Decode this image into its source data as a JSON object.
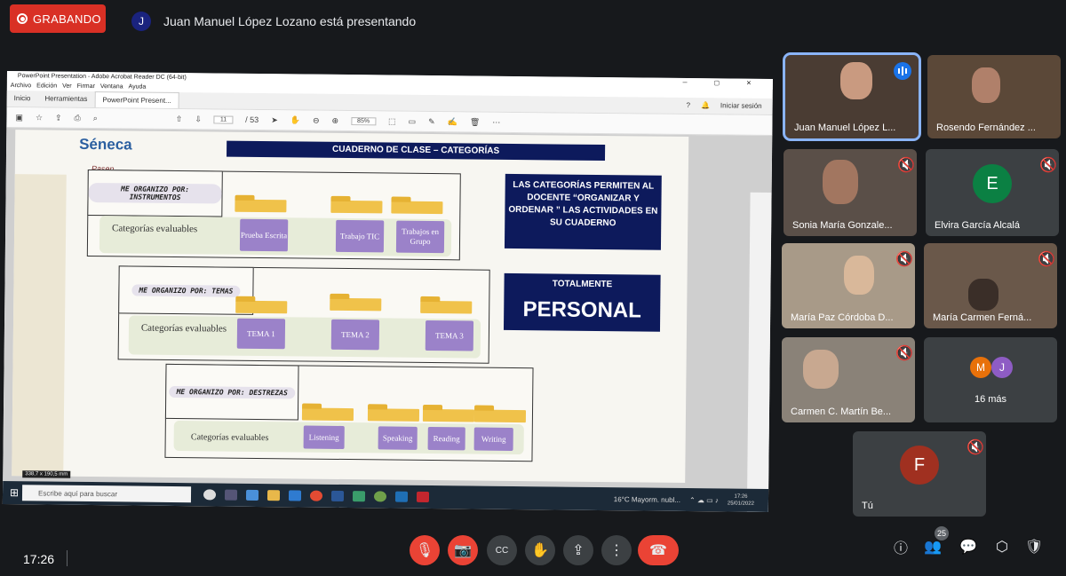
{
  "meeting": {
    "recording_label": "GRABANDO",
    "presenter_initial": "J",
    "presenter_text": "Juan Manuel López Lozano está presentando",
    "time": "17:26",
    "participant_count": "25"
  },
  "acrobat": {
    "window_title": "PowerPoint Presentation - Adobe Acrobat Reader DC (64-bit)",
    "menu": [
      "Archivo",
      "Edición",
      "Ver",
      "Firmar",
      "Ventana",
      "Ayuda"
    ],
    "tabs": [
      "Inicio",
      "Herramientas",
      "PowerPoint Present..."
    ],
    "sign_in": "Iniciar sesión",
    "page_current": "11",
    "page_total": "/ 53",
    "zoom": "85%",
    "page_size": "338,7 x 190,5 mm"
  },
  "slide": {
    "logo_text": "Séneca",
    "logo_sub": "Pasen",
    "title": "CUADERNO DE CLASE – CATEGORÍAS",
    "groups": [
      {
        "organizer": "ME ORGANIZO POR: INSTRUMENTOS",
        "label": "Categorías evaluables",
        "chips": [
          "Prueba Escrita",
          "Trabajo TIC",
          "Trabajos en Grupo"
        ]
      },
      {
        "organizer": "ME ORGANIZO POR: TEMAS",
        "label": "Categorías evaluables",
        "chips": [
          "TEMA 1",
          "TEMA 2",
          "TEMA 3"
        ]
      },
      {
        "organizer": "ME ORGANIZO POR: DESTREZAS",
        "label": "Categorías evaluables",
        "chips": [
          "Listening",
          "Speaking",
          "Reading",
          "Writing"
        ]
      }
    ],
    "info_box_1": "LAS CATEGORÍAS PERMITEN AL DOCENTE “ORGANIZAR Y ORDENAR ” LAS ACTIVIDADES EN SU CUADERNO",
    "info_box_2_small": "TOTALMENTE",
    "info_box_2_big": "PERSONAL"
  },
  "taskbar": {
    "search_placeholder": "Escribe aquí para buscar",
    "weather": "16°C  Mayorm. nubl...",
    "clock_time": "17:26",
    "clock_date": "25/01/2022"
  },
  "participants": [
    {
      "name": "Juan Manuel López L...",
      "state": "speaking"
    },
    {
      "name": "Rosendo Fernández ...",
      "state": "muted"
    },
    {
      "name": "Sonia María Gonzale...",
      "state": "muted"
    },
    {
      "name": "Elvira García Alcalá",
      "state": "muted",
      "initial": "E",
      "color": "#0b8043"
    },
    {
      "name": "María Paz Córdoba D...",
      "state": "muted"
    },
    {
      "name": "María Carmen Ferná...",
      "state": "muted"
    },
    {
      "name": "Carmen C. Martín Be...",
      "state": "muted"
    },
    {
      "name": "16 más",
      "initials": [
        "M",
        "J"
      ]
    },
    {
      "name": "Tú",
      "state": "muted",
      "initial": "F",
      "color": "#a03020"
    }
  ],
  "colors": {
    "record_red": "#d93025",
    "slide_navy": "#0d1a5c",
    "chip_purple": "#9b82c9",
    "folder_yellow": "#f0c24a",
    "end_call_red": "#ea4335"
  }
}
